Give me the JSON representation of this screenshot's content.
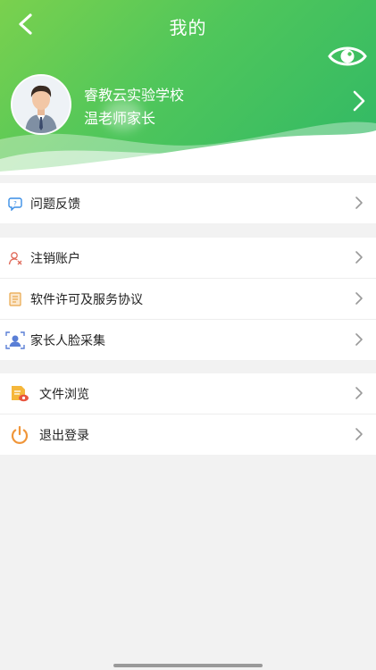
{
  "header": {
    "title": "我的",
    "school_name": "睿教云实验学校",
    "user_role": "温老师家长"
  },
  "menu_groups": [
    {
      "items": [
        {
          "label": "问题反馈",
          "icon": "feedback-icon"
        }
      ]
    },
    {
      "items": [
        {
          "label": "注销账户",
          "icon": "cancel-account-icon"
        },
        {
          "label": "软件许可及服务协议",
          "icon": "license-agreement-icon"
        },
        {
          "label": "家长人脸采集",
          "icon": "face-capture-icon"
        }
      ]
    },
    {
      "items": [
        {
          "label": "文件浏览",
          "icon": "file-browse-icon"
        },
        {
          "label": "退出登录",
          "icon": "power-icon"
        }
      ]
    }
  ],
  "colors": {
    "header_start": "#7ad14e",
    "header_end": "#2fb866",
    "background": "#f2f2f2"
  }
}
